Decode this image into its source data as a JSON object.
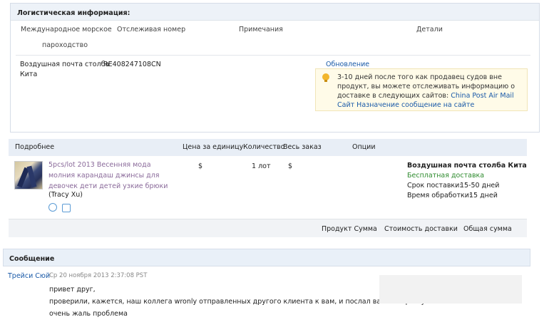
{
  "logistics": {
    "title": "Логистическая информация:",
    "columns": {
      "carrier_line1": "Международное морское",
      "carrier_line2": "пароходство",
      "tracking": "Отслеживая номер",
      "notes": "Примечания",
      "details": "Детали"
    },
    "row": {
      "carrier_line1": "Воздушная почта столба",
      "carrier_line2": "Кита",
      "tracking_number": "RE408247108CN",
      "update_link": "Обновление"
    },
    "notice": {
      "text": "3-10 дней после того как продавец судов вне продукт, вы можете отслеживать информацию о доставке в следующих сайтов: ",
      "link": "China Post Air Mail Сайт Назначение сообщение на сайте"
    }
  },
  "order": {
    "columns": {
      "details": "Подробнее",
      "unit_price": "Цена за единицу",
      "quantity": "Количество",
      "total_order": "Весь заказ",
      "options": "Опции"
    },
    "item": {
      "title": "5pcs/lot 2013 Весенняя мода молния карандаш джинсы для девочек дети детей узкие брюки",
      "seller": "(Tracy Xu)",
      "unit_price": "$",
      "quantity": "1 лот",
      "total": "$"
    },
    "shipping": {
      "method": "Воздушная почта столба Кита",
      "free": "Бесплатная доставка",
      "delivery_label": "Срок поставки:",
      "delivery_value": "15-50 дней",
      "processing_label": "Время обработки:",
      "processing_value": "15 дней"
    },
    "summary": {
      "product_sum": "Продукт Сумма",
      "shipping_cost": "Стоимость доставки",
      "total_sum": "Общая сумма"
    }
  },
  "message": {
    "title": "Сообщение",
    "author": "Трейси Сюй",
    "timestamp": "Ср 20 ноября 2013 2:37:08 PST",
    "lines": [
      "привет друг,",
      "проверили, кажется, наш коллега wronly отправленных другого клиента к вам, и послал ваш товар ему",
      "очень жаль проблема"
    ]
  },
  "colors": {
    "link": "#1a5aa8",
    "product_link": "#8a6a9a",
    "free_shipping": "#2e8b2e",
    "header_bg": "#e8eef6",
    "icon_blue": "#5b9bd5"
  },
  "icons": [
    "lightbulb-icon",
    "alarm-clock-icon",
    "calendar-icon"
  ]
}
